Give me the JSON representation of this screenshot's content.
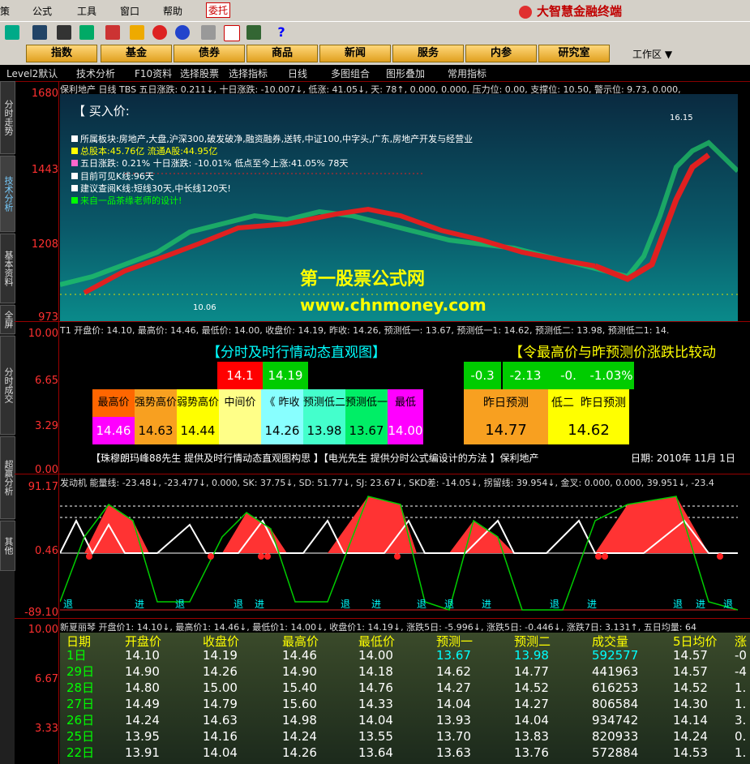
{
  "menu": {
    "items": [
      "策",
      "公式",
      "工具",
      "窗口",
      "帮助",
      "委托"
    ],
    "brand": "大智慧金融终端"
  },
  "nav": {
    "buttons": [
      "指数",
      "基金",
      "债券",
      "商品",
      "新闻",
      "服务",
      "内参",
      "研究室"
    ],
    "workspace": "工作区"
  },
  "tabs": [
    "Level2默认",
    "技术分析",
    "F10资料",
    "选择股票",
    "选择指标",
    "日线",
    "多图组合",
    "图形叠加",
    "常用指标"
  ],
  "sidebar": [
    "分时走势",
    "技术分析",
    "基本资料",
    "全屏",
    "分时成交",
    "超赢分析",
    "其他"
  ],
  "main_chart": {
    "header": "保利地产 日线 TBS  五日涨跌: 0.211↓, 十日涨跌: -10.007↓, 低涨: 41.05↓, 天: 78↑, 0.000, 0.000, 压力位: 0.00, 支撑位: 10.50, 警示位: 9.73, 0.000,",
    "y_ticks": [
      "1680",
      "1443",
      "1208",
      "973"
    ],
    "buy_label": "【 买入价:",
    "info_lines": [
      "所属板块:房地产,大盘,沪深300,破发破净,融资融券,送转,中证100,中字头,广东,房地产开发与经营业",
      "总股本:45.76亿   流通A股:44.95亿",
      "五日涨跌: 0.21%      十日涨跌: -10.01%   低点至今上涨:41.05%   78天",
      "目前可见K线:96天",
      "建议查阅K线:短线30天,中长线120天!",
      "来自一品茶缘老师的设计!"
    ],
    "info_colors": [
      "#ffffff",
      "#ffff00",
      "#ffffff",
      "#ffffff",
      "#ffffff",
      "#00ff00"
    ],
    "watermark1": "第一股票公式网",
    "watermark2": "www.chnmoney.com",
    "high_label": "16.15",
    "low_label": "10.06"
  },
  "panel2": {
    "header": "T1  开盘价: 14.10, 最高价: 14.46, 最低价: 14.00, 收盘价: 14.19, 昨收: 14.26, 预测低一: 13.67, 预测低一1: 14.62, 预测低二: 13.98, 预测低二1: 14.",
    "y_ticks": [
      "10.00",
      "6.65",
      "3.29",
      "0.00"
    ],
    "title_left": "【分时及时行情动态直观图】",
    "title_right": "【令最高价与昨预测价涨跌比较动",
    "top_vals": [
      "14.1",
      "14.19"
    ],
    "right_top": [
      "-0.3",
      "-2.13",
      "-0.",
      "-1.03%"
    ],
    "labels": [
      "最高价",
      "强势高价",
      "弱势高价",
      "中间价",
      "《 昨收",
      "预测低二",
      "预测低一",
      "最低"
    ],
    "values": [
      "14.46",
      "14.63",
      "14.44",
      "",
      "14.26",
      "13.98",
      "13.67",
      "14.00"
    ],
    "right_labels": [
      "昨日预测",
      "低二",
      "昨日预测"
    ],
    "right_vals": [
      "14.77",
      "14.62"
    ],
    "footer": "【珠穆朗玛峰88先生 提供及时行情动态直观图构思 】【电光先生 提供分时公式编设计的方法 】保利地产",
    "date": "日期: 2010年  11月  1日"
  },
  "panel3": {
    "header": "发动机  能量线: -23.48↓, -23.477↓, 0.000, SK: 37.75↓, SD: 51.77↓, SJ: 23.67↓, SKD差: -14.05↓, 拐留线: 39.954↓, 金叉: 0.000, 0.000, 39.951↓, -23.4",
    "y_ticks": [
      "91.17",
      "0.46",
      "-89.10"
    ],
    "bottom_marks": [
      "退",
      "进",
      "退",
      "退",
      "进",
      "退",
      "进",
      "退",
      "退",
      "进",
      "退",
      "进",
      "退",
      "进",
      "退"
    ]
  },
  "panel4": {
    "header": "新夏丽琴 开盘价1: 14.10↓, 最高价1: 14.46↓, 最低价1: 14.00↓, 收盘价1: 14.19↓, 涨跌5日: -5.996↓, 涨跌5日: -0.446↓, 涨跌7日: 3.131↑, 五日均量: 64",
    "y_ticks": [
      "10.00",
      "6.67",
      "3.33"
    ],
    "columns": [
      "日期",
      "开盘价",
      "收盘价",
      "最高价",
      "最低价",
      "预测一",
      "预测二",
      "成交量",
      "5日均价",
      "涨"
    ],
    "rows": [
      [
        "1日",
        "14.10",
        "14.19",
        "14.46",
        "14.00",
        "13.67",
        "13.98",
        "592577",
        "14.57",
        "-0"
      ],
      [
        "29日",
        "14.90",
        "14.26",
        "14.90",
        "14.18",
        "14.62",
        "14.77",
        "441963",
        "14.57",
        "-4"
      ],
      [
        "28日",
        "14.80",
        "15.00",
        "15.40",
        "14.76",
        "14.27",
        "14.52",
        "616253",
        "14.52",
        "1."
      ],
      [
        "27日",
        "14.49",
        "14.79",
        "15.60",
        "14.33",
        "14.04",
        "14.27",
        "806584",
        "14.30",
        "1."
      ],
      [
        "26日",
        "14.24",
        "14.63",
        "14.98",
        "14.04",
        "13.93",
        "14.04",
        "934742",
        "14.14",
        "3."
      ],
      [
        "25日",
        "13.95",
        "14.16",
        "14.24",
        "13.55",
        "13.70",
        "13.83",
        "820933",
        "14.24",
        "0."
      ],
      [
        "22日",
        "13.91",
        "14.04",
        "14.26",
        "13.64",
        "13.63",
        "13.76",
        "572884",
        "14.53",
        "1."
      ]
    ]
  }
}
